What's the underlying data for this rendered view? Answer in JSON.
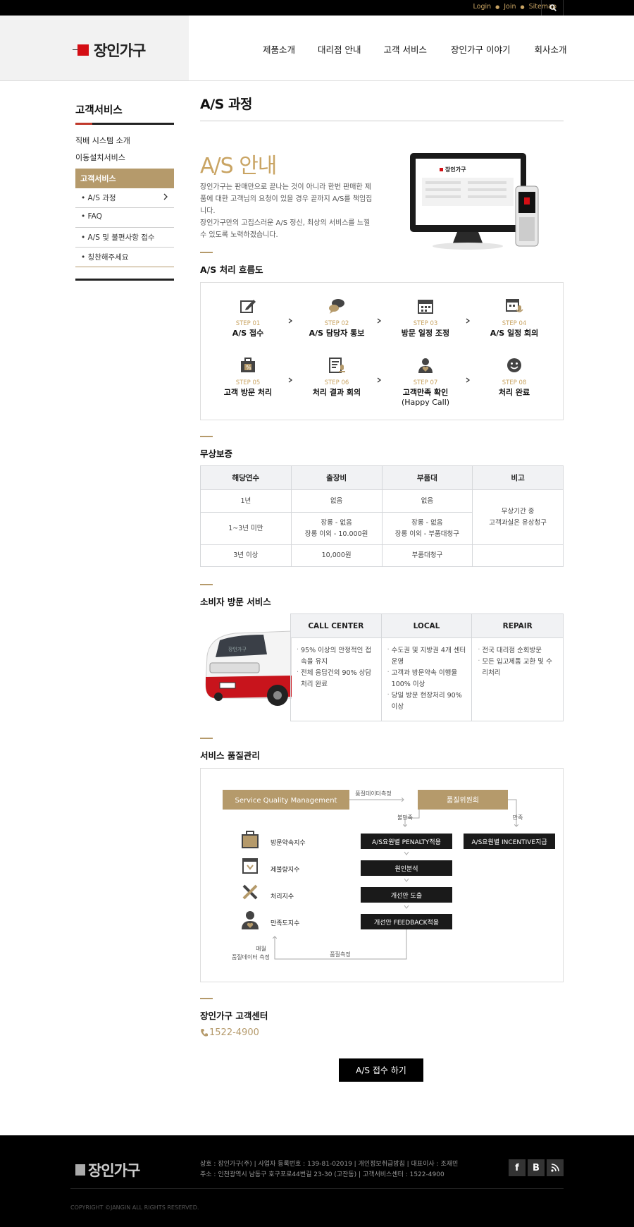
{
  "topbar": {
    "login": "Login",
    "join": "Join",
    "sitemap": "Sitemap",
    "search_icon": "search-icon"
  },
  "header": {
    "logo_text": "장인가구",
    "nav": [
      "제품소개",
      "대리점 안내",
      "고객 서비스",
      "장인가구 이야기",
      "회사소개"
    ]
  },
  "sidebar": {
    "title": "고객서비스",
    "items": [
      "직배 시스템 소개",
      "이동설치서비스"
    ],
    "active": "고객서비스",
    "sub_items": [
      "A/S 과정",
      "FAQ",
      "A/S 및 불편사항 접수",
      "칭찬해주세요"
    ]
  },
  "content": {
    "page_title": "A/S 과정",
    "intro_heading": "A/S 안내",
    "intro_text1": "장인가구는 판매만으로 끝나는 것이 아니라 한번 판매한 제품에 대한 고객님의 요청이 있을 경우 끝까지 A/S를 책임집니다.",
    "intro_text2": "장인가구만의 고집스러운 A/S 정신, 최상의 서비스를 느낄 수 있도록 노력하겠습니다.",
    "monitor_logo": "장인가구"
  },
  "flow": {
    "heading": "A/S 처리 흐름도",
    "steps": [
      {
        "num": "STEP 01",
        "label": "A/S 접수",
        "icon": "edit-icon"
      },
      {
        "num": "STEP 02",
        "label": "A/S 담당자 통보",
        "icon": "chat-icon"
      },
      {
        "num": "STEP 03",
        "label": "방문 일정 조정",
        "icon": "calendar-icon"
      },
      {
        "num": "STEP 04",
        "label": "A/S 일정 회의",
        "icon": "calendar-mic-icon"
      },
      {
        "num": "STEP 05",
        "label": "고객 방문 처리",
        "icon": "bag-icon"
      },
      {
        "num": "STEP 06",
        "label": "처리 결과 회의",
        "icon": "report-icon"
      },
      {
        "num": "STEP 07",
        "label": "고객만족 확인",
        "label2": "(Happy Call)",
        "icon": "person-heart-icon"
      },
      {
        "num": "STEP 08",
        "label": "처리 완료",
        "icon": "smile-icon"
      }
    ]
  },
  "warranty": {
    "heading": "무상보증",
    "headers": [
      "해당연수",
      "출장비",
      "부품대",
      "비고"
    ],
    "rows": [
      [
        "1년",
        "없음",
        "없음"
      ],
      [
        "1~3년 미만",
        "장롱 - 없음",
        "장롱 이외 - 10.000원",
        "장롱 - 없음",
        "장롱 이외 - 부품대청구"
      ],
      [
        "3년 이상",
        "10,000원",
        "부품대청구"
      ]
    ],
    "note_line1": "무상기간 중",
    "note_line2": "고객과실은 유상청구"
  },
  "visit": {
    "heading": "소비자 방문 서비스",
    "headers": [
      "CALL CENTER",
      "LOCAL",
      "REPAIR"
    ],
    "call_center": [
      "95% 이상의 안정적인 접속을 유지",
      "전체 응답건의 90% 상담 처리 완료"
    ],
    "local": [
      "수도권 및 지방권 4개 센터 운영",
      "고객과 방문약속 이행율 100% 이상",
      "당일 방문 현장처리 90% 이상"
    ],
    "repair": [
      "전국 대리점 순회방문",
      "모든 입고제품 교환 및 수리처리"
    ],
    "van_label": "장인가구"
  },
  "quality": {
    "heading": "서비스 품질관리",
    "sqm": "Service Quality Management",
    "measure": "품질데이터측정",
    "committee": "품질위원회",
    "dissatisfied": "불만족",
    "satisfied": "만족",
    "penalty": "A/S요원별 PENALTY적용",
    "incentive": "A/S요원별 INCENTIVE지급",
    "cause": "원인분석",
    "improve": "개선안 도출",
    "feedback": "개선안 FEEDBACK적용",
    "indices": [
      "방문약속지수",
      "제불량지수",
      "처리지수",
      "만족도지수"
    ],
    "monthly1": "매월",
    "monthly2": "품질데이터 측정",
    "quality_measure": "품질측정"
  },
  "center": {
    "heading": "장인가구 고객센터",
    "phone": "1522-4900",
    "button": "A/S 접수 하기"
  },
  "footer": {
    "logo_text": "장인가구",
    "line1": "상호 : 장인가구(주)  |  사업자 등록번호 : 139-81-02019  |  개인정보취급방침  |  대표이사 : 조재민",
    "line2": "주소 : 인천광역시 남동구 호구포로44번길 23-30 (고잔동)  |  고객서비스센터 : 1522-4900",
    "copyright": "COPYRIGHT ©JANGIN ALL RIGHTS RESERVED.",
    "sns": [
      "f",
      "B",
      "rss"
    ]
  }
}
